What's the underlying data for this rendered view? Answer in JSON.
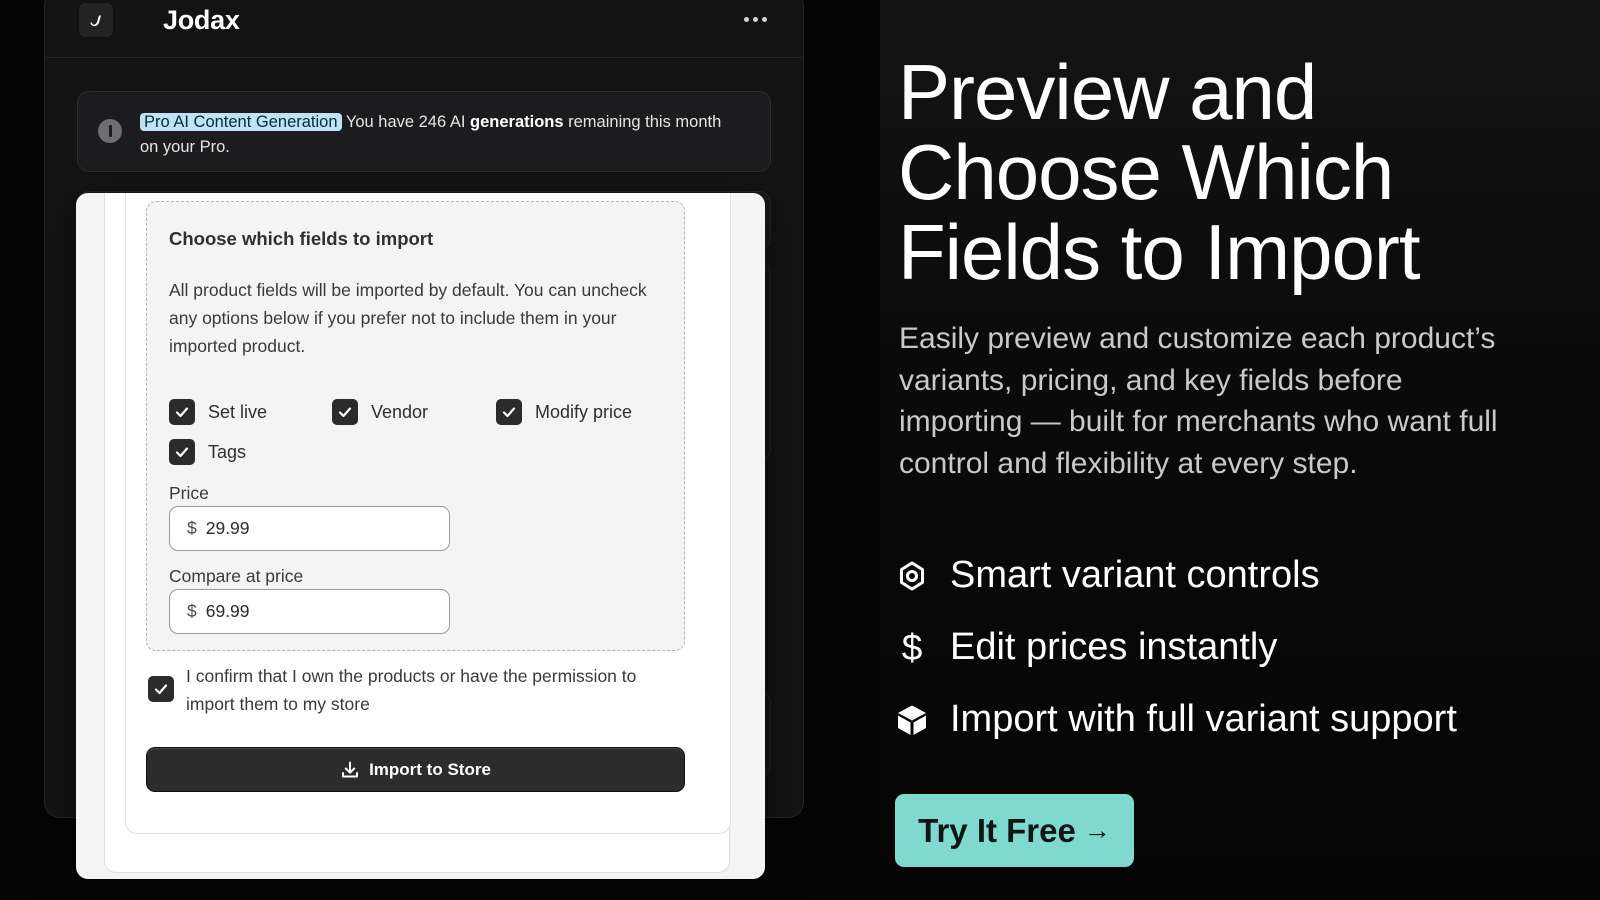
{
  "app": {
    "name": "Jodax",
    "menu_icon": "more-horizontal-icon"
  },
  "notice": {
    "badge": "Pro AI Content Generation",
    "text_before": " You have 246 AI ",
    "text_strong": "generations",
    "text_after": " remaining this month on your Pro."
  },
  "import_panel": {
    "title": "Choose which fields to import",
    "description": "All product fields will be imported by default. You can uncheck any options below if you prefer not to include them in your imported product.",
    "options": [
      {
        "label": "Set live",
        "checked": true
      },
      {
        "label": "Vendor",
        "checked": true
      },
      {
        "label": "Modify price",
        "checked": true
      },
      {
        "label": "Tags",
        "checked": true
      }
    ],
    "price": {
      "label": "Price",
      "currency": "$",
      "value": "29.99"
    },
    "compare_price": {
      "label": "Compare at price",
      "currency": "$",
      "value": "69.99"
    },
    "confirm": {
      "text": "I confirm that I own the products or have the permission to import them to my store",
      "checked": true
    },
    "import_button": "Import to Store"
  },
  "hero": {
    "title": "Preview and Choose Which Fields to Import",
    "description": "Easily preview and customize each product’s variants, pricing, and key fields before importing — built for merchants who want full control and flexibility at every step.",
    "features": [
      {
        "label": "Smart variant controls",
        "icon": "gear-icon"
      },
      {
        "label": "Edit prices instantly",
        "icon": "dollar-icon"
      },
      {
        "label": "Import with full variant support",
        "icon": "box-icon"
      }
    ],
    "cta": "Try It Free",
    "cta_arrow": "→"
  },
  "colors": {
    "background": "#050505",
    "accent": "#7fd9cf",
    "badge_highlight": "#bfe2f5",
    "button_dark": "#2c2c2c"
  }
}
